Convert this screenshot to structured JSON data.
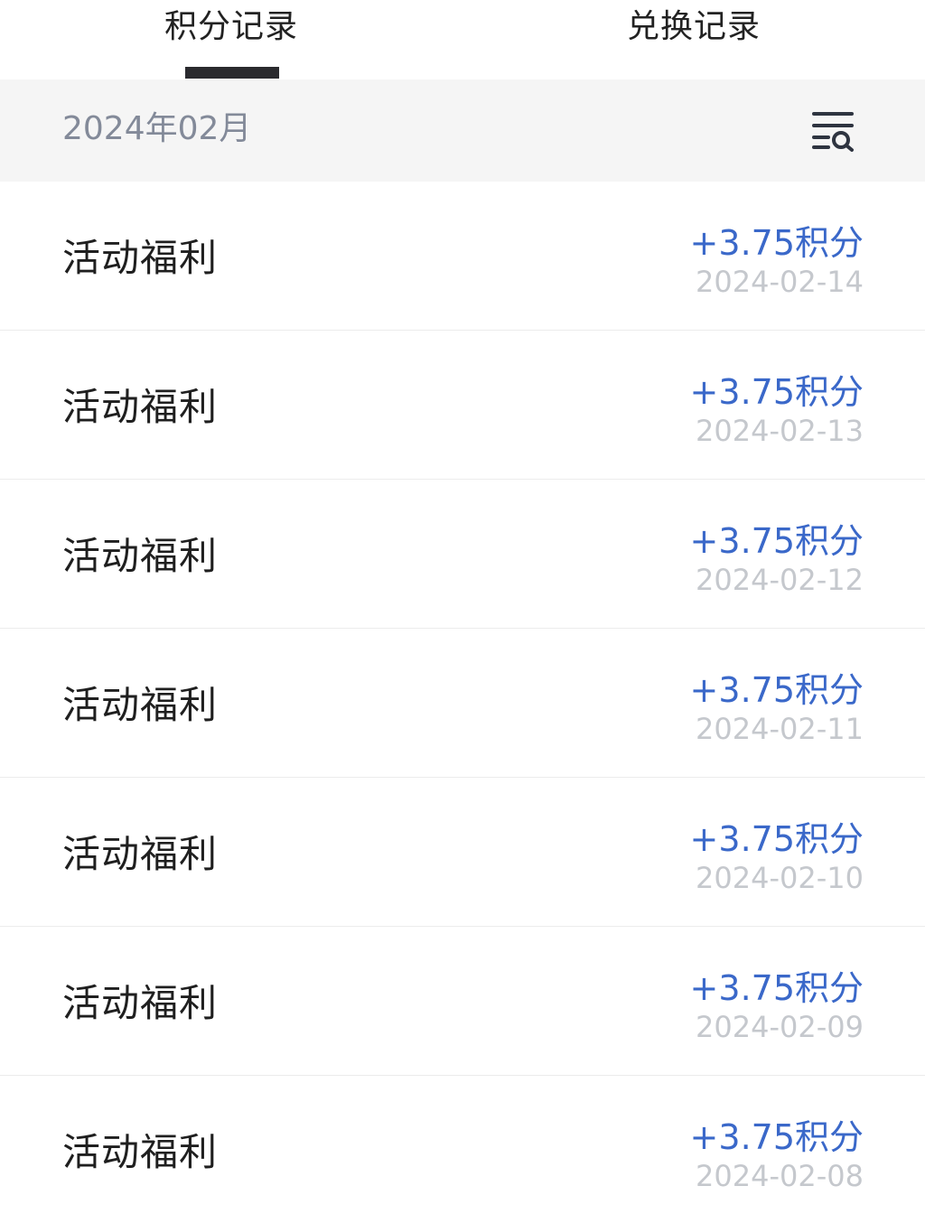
{
  "tabs": [
    {
      "label": "积分记录",
      "active": true
    },
    {
      "label": "兑换记录",
      "active": false
    }
  ],
  "month_header": {
    "label": "2024年02月",
    "filter_icon": "filter-search-icon"
  },
  "records": [
    {
      "title": "活动福利",
      "points": "+3.75积分",
      "date": "2024-02-14"
    },
    {
      "title": "活动福利",
      "points": "+3.75积分",
      "date": "2024-02-13"
    },
    {
      "title": "活动福利",
      "points": "+3.75积分",
      "date": "2024-02-12"
    },
    {
      "title": "活动福利",
      "points": "+3.75积分",
      "date": "2024-02-11"
    },
    {
      "title": "活动福利",
      "points": "+3.75积分",
      "date": "2024-02-10"
    },
    {
      "title": "活动福利",
      "points": "+3.75积分",
      "date": "2024-02-09"
    },
    {
      "title": "活动福利",
      "points": "+3.75积分",
      "date": "2024-02-08"
    }
  ],
  "colors": {
    "accent": "#3a68c9",
    "tab_indicator": "#2a2a2e",
    "month_bar_bg": "#f5f5f5",
    "date_text": "#c5c8cd"
  }
}
